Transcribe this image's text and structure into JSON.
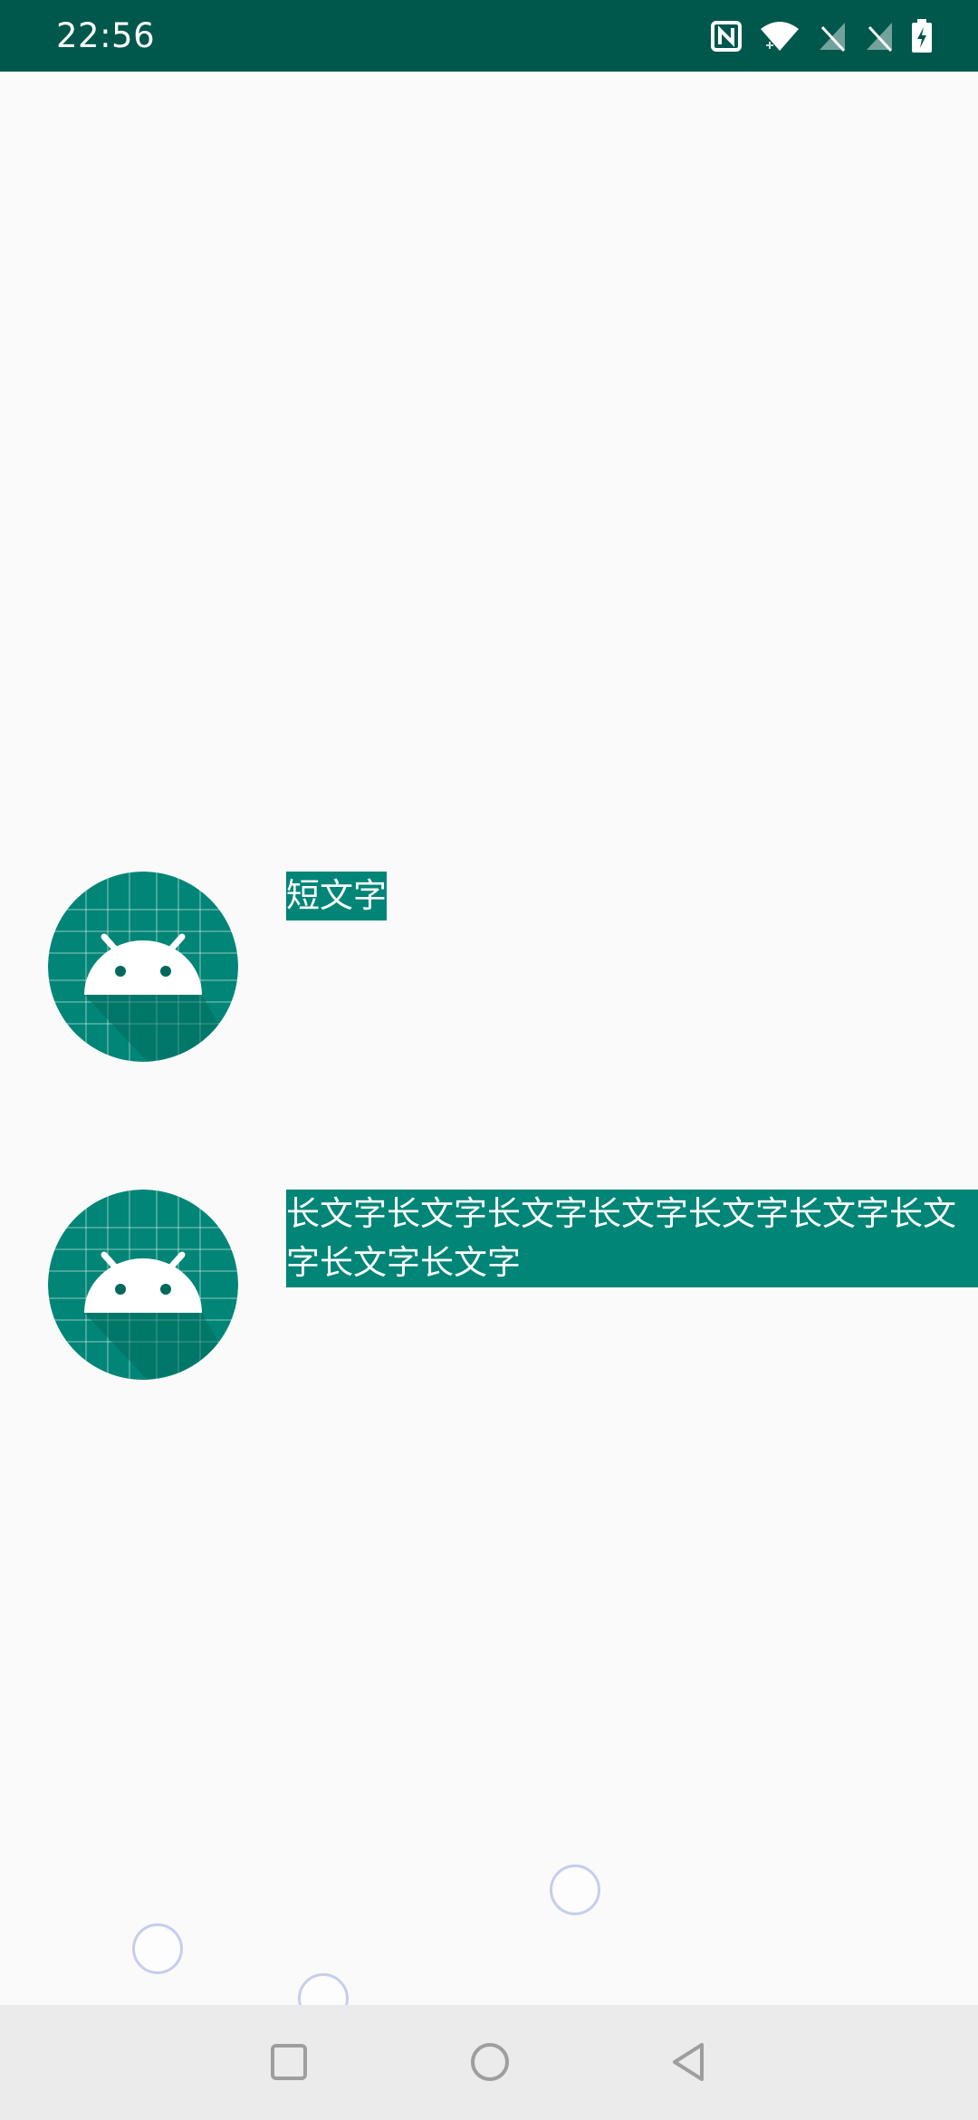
{
  "status_bar": {
    "time": "22:56",
    "icons": [
      "nfc-icon",
      "wifi-icon",
      "signal-off-icon",
      "signal-off-icon",
      "battery-charging-icon"
    ],
    "background": "#00574b"
  },
  "content": {
    "items": [
      {
        "icon": "android-app-icon",
        "text": "短文字"
      },
      {
        "icon": "android-app-icon",
        "text": "长文字长文字长文字长文字长文字长文字长文字长文字长文字"
      }
    ],
    "label_background": "#008577",
    "icon_background": "#008577"
  },
  "nav_bar": {
    "buttons": [
      "recents-square-icon",
      "home-circle-icon",
      "back-triangle-icon"
    ]
  }
}
